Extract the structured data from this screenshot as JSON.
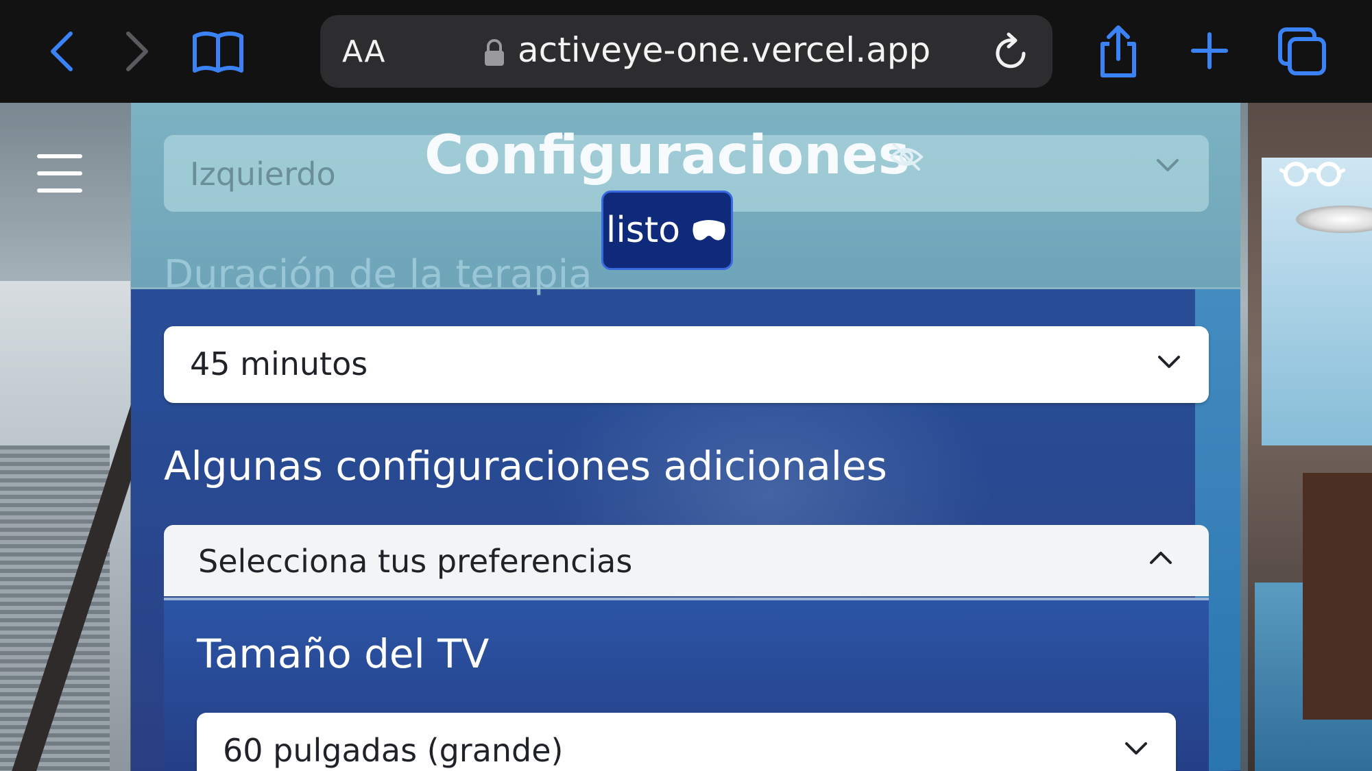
{
  "browser": {
    "aa_label": "AA",
    "url": "activeye-one.vercel.app"
  },
  "panel": {
    "title": "Configuraciones",
    "done_button": "listo",
    "eye_side_value": "Izquierdo",
    "duration_heading": "Duración de la terapia",
    "duration_value": "45 minutos",
    "additional_heading": "Algunas configuraciones adicionales",
    "preferences_toggle": "Selecciona tus preferencias",
    "tv_size_heading": "Tamaño del TV",
    "tv_size_value": "60 pulgadas (grande)"
  },
  "icons": {
    "back": "chevron-left-icon",
    "forward": "chevron-right-icon",
    "bookmarks": "book-icon",
    "lock": "lock-icon",
    "reload": "reload-icon",
    "share": "share-icon",
    "new_tab": "plus-icon",
    "tabs": "tabs-icon",
    "menu": "hamburger-icon",
    "glasses": "glasses-icon",
    "hidden": "eye-slash-icon",
    "vr": "vr-headset-icon"
  },
  "colors": {
    "toolbar": "#121212",
    "accent_blue": "#3b82f6",
    "panel_blue": "#2b4f97",
    "done_button": "#0f2a7a"
  }
}
